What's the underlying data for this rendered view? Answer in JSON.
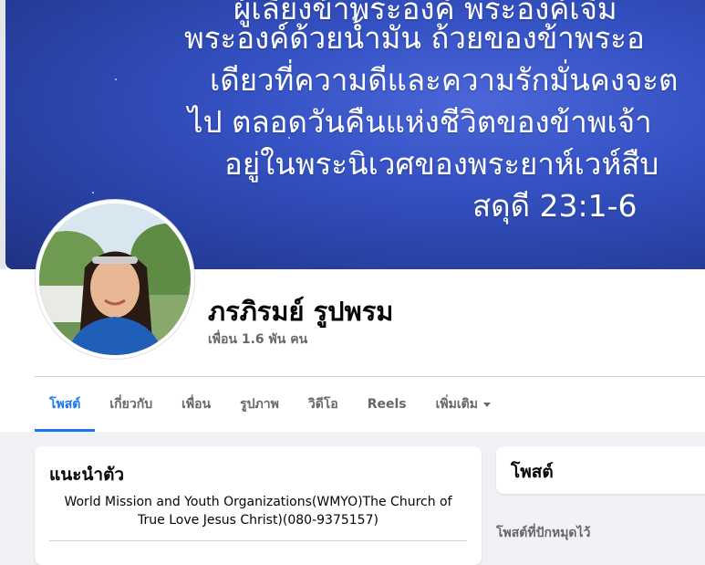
{
  "cover": {
    "lines": [
      "ผู้เลี้ยงข้าพระองค์ พระองค์เจิม",
      "พระองค์ด้วยน้ำมัน ถ้วยของข้าพระอ",
      "เดียวที่ความดีและความรักมั่นคงจะต",
      "ไป ตลอดวันคืนแห่งชีวิตของข้าพเจ้า",
      "อยู่ในพระนิเวศของพระยาห์เวห์สืบ",
      "สดุดี 23:1-6"
    ],
    "background_color": "#3552c4"
  },
  "profile": {
    "name": "ภรภิรมย์ รูปพรม",
    "friends": "เพื่อน 1.6 พัน คน"
  },
  "tabs": [
    {
      "label": "โพสต์",
      "active": true
    },
    {
      "label": "เกี่ยวกับ",
      "active": false
    },
    {
      "label": "เพื่อน",
      "active": false
    },
    {
      "label": "รูปภาพ",
      "active": false
    },
    {
      "label": "วิดีโอ",
      "active": false
    },
    {
      "label": "Reels",
      "active": false
    },
    {
      "label": "เพิ่มเติม",
      "active": false,
      "icon": "caret-down-icon"
    }
  ],
  "intro": {
    "title": "แนะนำตัว",
    "bio": "World Mission and Youth Organizations(WMYO)The Church of True Love Jesus Christ)(080-9375157)"
  },
  "posts": {
    "title": "โพสต์",
    "pinned_label": "โพสต์ที่ปักหมุดไว้"
  },
  "colors": {
    "accent": "#1877f2",
    "secondary_text": "#65676b",
    "page_background": "#f0f2f5"
  }
}
